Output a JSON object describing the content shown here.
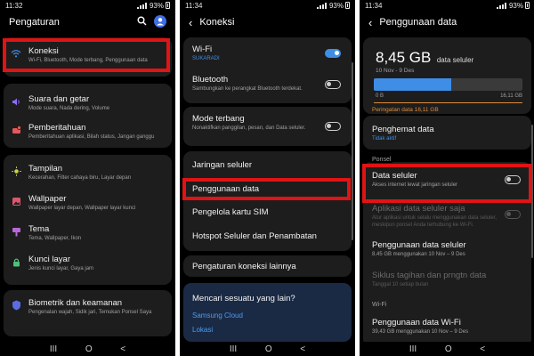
{
  "status": [
    {
      "time": "11:32",
      "battery": "93%"
    },
    {
      "time": "11:34",
      "battery": "93%"
    },
    {
      "time": "11:34",
      "battery": "93%"
    }
  ],
  "screen1": {
    "title": "Pengaturan",
    "items": [
      {
        "title": "Koneksi",
        "sub": "Wi-Fi, Bluetooth, Mode terbang, Penggunaan data",
        "icon": "wifi-icon",
        "color": "#3e8ee6"
      },
      {
        "title": "Suara dan getar",
        "sub": "Mode suara, Nada dering, Volume",
        "icon": "speaker-icon",
        "color": "#8c6cf0"
      },
      {
        "title": "Pemberitahuan",
        "sub": "Pemberitahuan aplikasi, Bilah status, Jangan ganggu",
        "icon": "notification-icon",
        "color": "#e2595a"
      },
      {
        "title": "Tampilan",
        "sub": "Kecerahan, Filter cahaya biru, Layar depan",
        "icon": "sun-icon",
        "color": "#c8d24a"
      },
      {
        "title": "Wallpaper",
        "sub": "Wallpaper layar depan, Wallpaper layar kunci",
        "icon": "wallpaper-icon",
        "color": "#d8586e"
      },
      {
        "title": "Tema",
        "sub": "Tema, Wallpaper, Ikon",
        "icon": "theme-icon",
        "color": "#b768d8"
      },
      {
        "title": "Kunci layar",
        "sub": "Jenis kunci layar, Gaya jam",
        "icon": "lock-icon",
        "color": "#4fbf7a"
      },
      {
        "title": "Biometrik dan keamanan",
        "sub": "Pengenalan wajah, Sidik jari, Temukan Ponsel Saya",
        "icon": "shield-icon",
        "color": "#5b6de0"
      }
    ]
  },
  "screen2": {
    "title": "Koneksi",
    "wifi": {
      "title": "Wi-Fi",
      "sub": "SUKARADI"
    },
    "bluetooth": {
      "title": "Bluetooth",
      "sub": "Sambungkan ke perangkat Bluetooth terdekat."
    },
    "airplane": {
      "title": "Mode terbang",
      "sub": "Nonaktifkan panggilan, pesan, dan Data seluler."
    },
    "menu": [
      "Jaringan seluler",
      "Penggunaan data",
      "Pengelola kartu SIM",
      "Hotspot Seluler dan Penambatan"
    ],
    "more": "Pengaturan koneksi lainnya",
    "search": {
      "title": "Mencari sesuatu yang lain?",
      "links": [
        "Samsung Cloud",
        "Lokasi"
      ]
    }
  },
  "screen3": {
    "title": "Penggunaan data",
    "amount": "8,45 GB",
    "amount_label": "data seluler",
    "period": "10 Nov - 9 Des",
    "usage_fraction": 0.52,
    "bar_min": "0 B",
    "bar_max": "16,11 GB",
    "warning": "Peringatan data 16,11 GB",
    "saver": {
      "title": "Penghemat data",
      "sub": "Tidak aktif"
    },
    "mobile_data": {
      "title": "Data seluler",
      "sub": "Akses internet lewat jaringan seluler"
    },
    "section_ponsel": "Ponsel",
    "apps_only": {
      "title": "Aplikasi data seluler saja",
      "sub": "Atur aplikasi untuk selalu menggunakan data seluler, meskipun ponsel Anda terhubung ke Wi-Fi."
    },
    "usage": {
      "title": "Penggunaan data seluler",
      "sub": "8,45 GB menggunakan 10 Nov – 9 Des"
    },
    "cycle": {
      "title": "Siklus tagihan dan prngtn data",
      "sub": "Tanggal 10 setiap bulan"
    },
    "section_wifi": "Wi-Fi",
    "wifi_usage": {
      "title": "Penggunaan data Wi-Fi",
      "sub": "39,43 GB menggunakan 10 Nov – 9 Des"
    }
  },
  "nav": {
    "recent": "III",
    "home": "O",
    "back": "<"
  }
}
